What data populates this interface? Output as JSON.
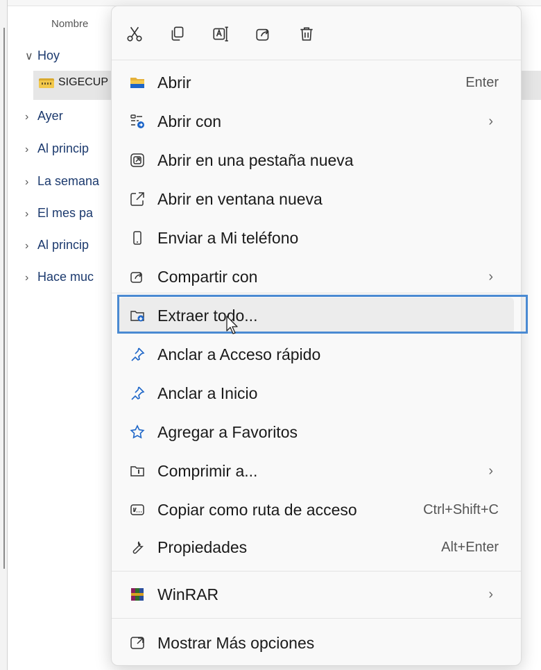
{
  "explorer": {
    "column_header": "Nombre",
    "groups": [
      {
        "label": "Hoy",
        "expanded": true
      },
      {
        "label": "Ayer",
        "expanded": false
      },
      {
        "label": "Al princip",
        "expanded": false
      },
      {
        "label": "La semana",
        "expanded": false
      },
      {
        "label": "El mes pa",
        "expanded": false
      },
      {
        "label": "Al princip",
        "expanded": false
      },
      {
        "label": "Hace muc",
        "expanded": false
      }
    ],
    "selected_file": "SIGECUP"
  },
  "toolbar": {
    "icons": [
      "cut-icon",
      "copy-icon",
      "rename-icon",
      "share-icon",
      "delete-icon"
    ]
  },
  "menu": {
    "items": [
      {
        "label": "Abrir",
        "shortcut": "Enter",
        "submenu": false,
        "icon": "folder-icon"
      },
      {
        "label": "Abrir con",
        "shortcut": "",
        "submenu": true,
        "icon": "open-with-icon"
      },
      {
        "label": "Abrir en una pestaña nueva",
        "shortcut": "",
        "submenu": false,
        "icon": "new-tab-icon"
      },
      {
        "label": "Abrir en ventana nueva",
        "shortcut": "",
        "submenu": false,
        "icon": "new-window-icon"
      },
      {
        "label": "Enviar a Mi teléfono",
        "shortcut": "",
        "submenu": false,
        "icon": "phone-icon"
      },
      {
        "label": "Compartir con",
        "shortcut": "",
        "submenu": true,
        "icon": "share-icon"
      },
      {
        "label": "Extraer todo...",
        "shortcut": "",
        "submenu": false,
        "icon": "extract-icon"
      },
      {
        "label": "Anclar a Acceso rápido",
        "shortcut": "",
        "submenu": false,
        "icon": "pin-icon"
      },
      {
        "label": "Anclar a Inicio",
        "shortcut": "",
        "submenu": false,
        "icon": "pin-icon"
      },
      {
        "label": "Agregar a Favoritos",
        "shortcut": "",
        "submenu": false,
        "icon": "star-icon"
      },
      {
        "label": "Comprimir a...",
        "shortcut": "",
        "submenu": true,
        "icon": "compress-icon"
      },
      {
        "label": "Copiar como ruta de acceso",
        "shortcut": "Ctrl+Shift+C",
        "submenu": false,
        "icon": "copy-path-icon"
      },
      {
        "label": "Propiedades",
        "shortcut": "Alt+Enter",
        "submenu": false,
        "icon": "wrench-icon"
      },
      {
        "label": "WinRAR",
        "shortcut": "",
        "submenu": true,
        "icon": "winrar-icon"
      },
      {
        "label": "Mostrar Más opciones",
        "shortcut": "",
        "submenu": false,
        "icon": "more-options-icon"
      }
    ],
    "highlighted": "Extraer todo...",
    "accent_color": "#4a8ad2"
  }
}
